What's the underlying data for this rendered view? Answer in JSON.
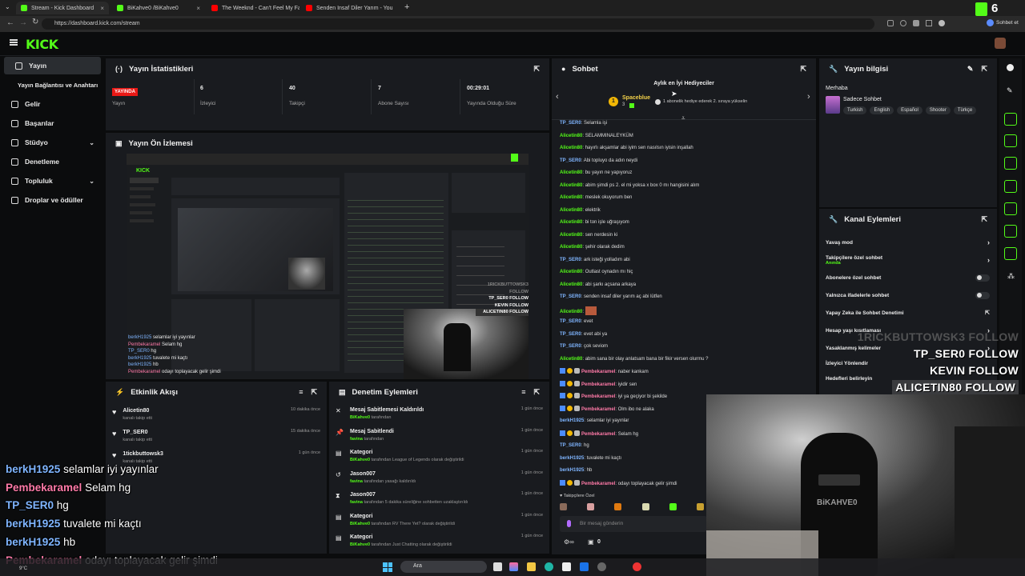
{
  "browser": {
    "tabs": [
      {
        "label": "Stream - Kick Dashboard",
        "icon": "kick-icon"
      },
      {
        "label": "BiKahve0 /BiKahve0",
        "icon": "kick-icon"
      },
      {
        "label": "The Weeknd - Can't Feel My Face",
        "icon": "youtube-icon"
      },
      {
        "label": "Senden Insaf Diler Yarım - You",
        "icon": "youtube-icon"
      }
    ],
    "address": "https://dashboard.kick.com/stream",
    "profile_label": "Sohbet et",
    "kick_count": "6"
  },
  "sidebar": {
    "items": [
      {
        "label": "Yayın",
        "icon": "broadcast-icon"
      },
      {
        "label": "Yayın Bağlantısı ve Anahtarı",
        "icon": ""
      },
      {
        "label": "Gelir",
        "icon": "wallet-icon"
      },
      {
        "label": "Başarılar",
        "icon": "trophy-icon"
      },
      {
        "label": "Stüdyo",
        "icon": "studio-icon"
      },
      {
        "label": "Denetleme",
        "icon": "shield-icon"
      },
      {
        "label": "Topluluk",
        "icon": "people-icon"
      },
      {
        "label": "Droplar ve ödüller",
        "icon": "gift-icon"
      }
    ]
  },
  "stats": {
    "title": "Yayın İstatistikleri",
    "live_badge": "YAYINDA",
    "items": [
      {
        "value": "",
        "label": "Yayın"
      },
      {
        "value": "6",
        "label": "İzleyici"
      },
      {
        "value": "40",
        "label": "Takipçi"
      },
      {
        "value": "7",
        "label": "Abone Sayısı"
      },
      {
        "value": "00:29:01",
        "label": "Yayında Olduğu Süre"
      }
    ]
  },
  "preview": {
    "title": "Yayın Ön İzlemesi"
  },
  "activity": {
    "title": "Etkinlik Akışı",
    "items": [
      {
        "name": "Alicetin80",
        "sub": "kanalı takip etti",
        "time": "10 dakika önce"
      },
      {
        "name": "TP_SER0",
        "sub": "kanalı takip etti",
        "time": "15 dakika önce"
      },
      {
        "name": "1tickbuttowsk3",
        "sub": "kanalı takip etti",
        "time": "1 gün önce"
      }
    ]
  },
  "moderation": {
    "title": "Denetim Eylemleri",
    "items": [
      {
        "title": "Mesaj Sabitlemesi Kaldırıldı",
        "user": "BiKahve0",
        "rest": "tarafından",
        "time": "1 gün önce",
        "icon": "pin-off-icon"
      },
      {
        "title": "Mesaj Sabitlendi",
        "user": "favina",
        "rest": "tarafından",
        "time": "1 gün önce",
        "icon": "pin-icon"
      },
      {
        "title": "Kategori",
        "user": "BiKahve0",
        "rest": "tarafından League of Legends olarak değiştirildi",
        "time": "1 gün önce",
        "icon": "category-icon"
      },
      {
        "title": "Jason007",
        "user": "favina",
        "rest": "tarafından yasağı kaldırıldı",
        "time": "1 gün önce",
        "icon": "unban-icon"
      },
      {
        "title": "Jason007",
        "user": "favina",
        "rest": "tarafından 5 dakika süreliğine sohbetten uzaklaştırıldı",
        "time": "1 gün önce",
        "icon": "timeout-icon"
      },
      {
        "title": "Kategori",
        "user": "BiKahve0",
        "rest": "tarafından RV There Yet? olarak değiştirildi",
        "time": "1 gün önce",
        "icon": "category-icon"
      },
      {
        "title": "Kategori",
        "user": "BiKahve0",
        "rest": "tarafından Just Chatting olarak değiştirildi",
        "time": "1 gün önce",
        "icon": "category-icon"
      }
    ]
  },
  "chat": {
    "title": "Sohbet",
    "gifters_title": "Aylık en İyi Hediyeciler",
    "top_gifter": {
      "name": "Spaceblue",
      "count": "3",
      "rank": "1"
    },
    "gift_hint": "1 abonelik hediye ederek 2. sıraya yükselin",
    "messages": [
      {
        "user": "TP_SER0",
        "text": "Selamla işi",
        "color": "blue"
      },
      {
        "user": "Alicetin80",
        "text": "SELAMMINALEYKÜM",
        "color": "green"
      },
      {
        "user": "Alicetin80",
        "text": "hayırlı akşamlar abi iyim sen nasılsın iyisin inşallah",
        "color": "green"
      },
      {
        "user": "TP_SER0",
        "text": "Abi topluyo da adın neydi",
        "color": "blue"
      },
      {
        "user": "Alicetin80",
        "text": "bu yayın ne yapıyoruz",
        "color": "green"
      },
      {
        "user": "Alicetin80",
        "text": "abim şimdi ps 2. el mi yoksa x box 0 mı hangisini alım",
        "color": "green"
      },
      {
        "user": "Alicetin80",
        "text": "meslek okuyorum ben",
        "color": "green"
      },
      {
        "user": "Alicetin80",
        "text": "elektrik",
        "color": "green"
      },
      {
        "user": "Alicetin80",
        "text": "bi ton işle uğraşıyom",
        "color": "green"
      },
      {
        "user": "Alicetin80",
        "text": "sen nerdesin ki",
        "color": "green"
      },
      {
        "user": "Alicetin80",
        "text": "şehir olarak dedim",
        "color": "green"
      },
      {
        "user": "TP_SER0",
        "text": "ark isteği yolladım abi",
        "color": "blue"
      },
      {
        "user": "Alicetin80",
        "text": "Outlast oynadın mı hiç",
        "color": "green"
      },
      {
        "user": "Alicetin80",
        "text": "abi şarkı açsana arkaya",
        "color": "green"
      },
      {
        "user": "TP_SER0",
        "text": "senden insaf diler yarım aç abi lütfen",
        "color": "blue"
      },
      {
        "user": "Alicetin80",
        "text": "",
        "color": "green",
        "emote": true
      },
      {
        "user": "TP_SER0",
        "text": "evet",
        "color": "blue"
      },
      {
        "user": "TP_SER0",
        "text": "evet abi ya",
        "color": "blue"
      },
      {
        "user": "TP_SER0",
        "text": "çok seviom",
        "color": "blue"
      },
      {
        "user": "Alicetin80",
        "text": "abim sana bir olay anlatsam bana bir fikir versen olurmu ?",
        "color": "green"
      },
      {
        "user": "Pembekaramel",
        "text": "naber kankam",
        "color": "pink",
        "badges": true
      },
      {
        "user": "Pembekaramel",
        "text": "iyidir sen",
        "color": "pink",
        "badges": true
      },
      {
        "user": "Pembekaramel",
        "text": "iyi ya geçiyor bi şekilde",
        "color": "pink",
        "badges": true
      },
      {
        "user": "Pembekaramel",
        "text": "Olm ibo ne alaka",
        "color": "pink",
        "badges": true
      },
      {
        "user": "berkH1925",
        "text": "selamlar iyi yayınlar",
        "color": "blue"
      },
      {
        "user": "Pembekaramel",
        "text": "Selam hg",
        "color": "pink",
        "badges": true
      },
      {
        "user": "TP_SER0",
        "text": "hg",
        "color": "blue"
      },
      {
        "user": "berkH1925",
        "text": "tuvalete mi kaçtı",
        "color": "blue"
      },
      {
        "user": "berkH1925",
        "text": "hb",
        "color": "blue"
      },
      {
        "user": "Pembekaramel",
        "text": "odayı toplayacak gelir şimdi",
        "color": "pink",
        "badges": true
      }
    ],
    "followers_only": "Takipçilere Özel",
    "input_placeholder": "Bir mesaj gönderin",
    "points": "0"
  },
  "stream_info": {
    "title": "Yayın bilgisi",
    "greeting": "Merhaba",
    "category": "Sadece Sohbet",
    "tags": [
      "Turkish",
      "English",
      "Español",
      "Shooter",
      "Türkçe"
    ]
  },
  "channel_actions": {
    "title": "Kanal Eylemleri",
    "items": [
      {
        "label": "Yavaş mod",
        "sub": "",
        "control": "arrow"
      },
      {
        "label": "Takipçilere özel sohbet",
        "sub": "Anında",
        "control": "arrow"
      },
      {
        "label": "Abonelere özel sohbet",
        "sub": "",
        "control": "toggle"
      },
      {
        "label": "Yalnızca ifadelerle sohbet",
        "sub": "",
        "control": "toggle"
      },
      {
        "label": "Yapay Zeka ile Sohbet Denetimi",
        "sub": "",
        "control": "external"
      },
      {
        "label": "Hesap yaşı kısıtlaması",
        "sub": "",
        "control": "arrow"
      },
      {
        "label": "Yasaklanmış kelimeler",
        "sub": "",
        "control": "arrow"
      },
      {
        "label": "İzleyici Yönlendir",
        "sub": "",
        "control": ""
      },
      {
        "label": "Hedefleri belirleyin",
        "sub": "",
        "control": ""
      }
    ]
  },
  "overlay_chat": [
    {
      "user": "berkH1925",
      "text": "selamlar iyi yayınlar",
      "color": "blue"
    },
    {
      "user": "Pembekaramel",
      "text": "Selam hg",
      "color": "pink"
    },
    {
      "user": "TP_SER0",
      "text": "hg",
      "color": "blue"
    },
    {
      "user": "berkH1925",
      "text": "tuvalete mi kaçtı",
      "color": "blue"
    },
    {
      "user": "berkH1925",
      "text": "hb",
      "color": "blue"
    },
    {
      "user": "Pembekaramel",
      "text": "odayı toplayacak gelir şimdi",
      "color": "pink"
    }
  ],
  "follow_alerts": [
    "1RICKBUTTOWSK3 FOLLOW",
    "TP_SER0 FOLLOW",
    "KEVIN FOLLOW",
    "ALICETIN80 FOLLOW"
  ],
  "taskbar": {
    "search": "Ara",
    "temp": "9°C"
  },
  "colors": {
    "kick_green": "#53fc18",
    "panel_bg": "#191b1f",
    "page_bg": "#0b0c0d",
    "live_red": "#e91916"
  }
}
